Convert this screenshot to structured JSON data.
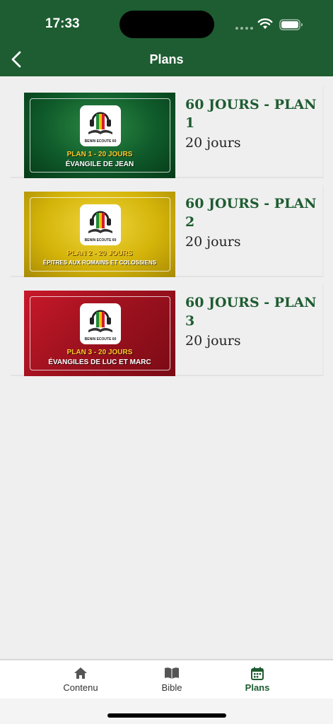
{
  "status_bar": {
    "time": "17:33"
  },
  "nav": {
    "title": "Plans",
    "back_icon": "chevron-left-icon"
  },
  "plans": [
    {
      "title": "60 JOURS - PLAN 1",
      "duration": "20 jours",
      "thumbnail": {
        "logo_text": "BENIN ECOUTE 60",
        "plan_line": "PLAN 1 - 20 JOURS",
        "book_line": "ÉVANGILE DE JEAN",
        "bg_color": "#0f5a2a"
      }
    },
    {
      "title": "60 JOURS - PLAN 2",
      "duration": "20 jours",
      "thumbnail": {
        "logo_text": "BENIN ECOUTE 60",
        "plan_line": "PLAN 2 - 20 JOURS",
        "book_line": "ÉPITRES AUX ROMAINS ET COLOSSIENS",
        "bg_color": "#d4b409"
      }
    },
    {
      "title": "60 JOURS - PLAN 3",
      "duration": "20 jours",
      "thumbnail": {
        "logo_text": "BENIN ECOUTE 60",
        "plan_line": "PLAN 3 - 20 JOURS",
        "book_line": "ÉVANGILES DE  LUC ET MARC",
        "bg_color": "#a0121f"
      }
    }
  ],
  "tabbar": {
    "tabs": [
      {
        "label": "Contenu",
        "icon": "home-icon",
        "active": false
      },
      {
        "label": "Bible",
        "icon": "book-open-icon",
        "active": false
      },
      {
        "label": "Plans",
        "icon": "calendar-icon",
        "active": true
      }
    ]
  },
  "colors": {
    "brand_green": "#1e5c31",
    "background": "#efefef",
    "plan_line_yellow": "#ffc928"
  }
}
